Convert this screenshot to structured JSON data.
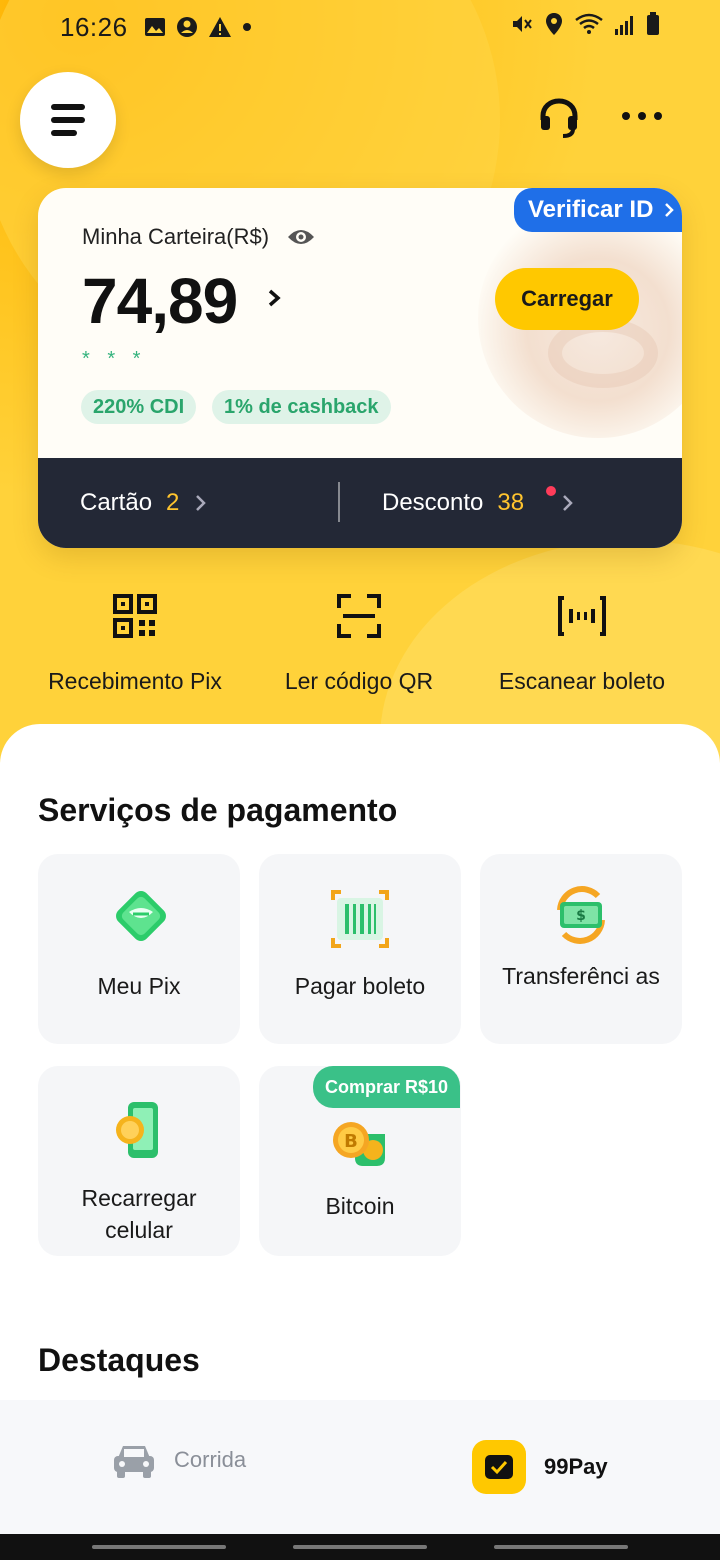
{
  "status_bar": {
    "time": "16:26"
  },
  "header": {
    "menu_icon": "hamburger-icon",
    "support_icon": "headset-icon",
    "more_icon": "more-dots-icon"
  },
  "wallet": {
    "label": "Minha Carteira(R$)",
    "balance": "74,89",
    "masked": "* * *",
    "tags": [
      "220% CDI",
      "1% de cashback"
    ],
    "charge_button": "Carregar",
    "verify_badge": "Verificar ID",
    "card_label": "Cartão",
    "card_count": "2",
    "discount_label": "Desconto",
    "discount_count": "38"
  },
  "quick_actions": [
    {
      "label": "Recebimento Pix",
      "icon": "qr-code-icon"
    },
    {
      "label": "Ler código QR",
      "icon": "scan-frame-icon"
    },
    {
      "label": "Escanear boleto",
      "icon": "barcode-scan-icon"
    }
  ],
  "payment_services": {
    "title": "Serviços de pagamento",
    "items": [
      {
        "label": "Meu Pix",
        "icon": "pix-icon"
      },
      {
        "label": "Pagar boleto",
        "icon": "boleto-icon"
      },
      {
        "label": "Transferênci as",
        "icon": "transfer-money-icon"
      },
      {
        "label": "Recarregar celular",
        "icon": "phone-recharge-icon"
      },
      {
        "label": "Bitcoin",
        "icon": "bitcoin-icon"
      }
    ],
    "bitcoin_badge": "Comprar R$10"
  },
  "highlights": {
    "title": "Destaques"
  },
  "bottom_nav": [
    {
      "label": "Corrida",
      "icon": "car-icon"
    },
    {
      "label": "99Pay",
      "icon": "wallet-check-icon"
    }
  ],
  "colors": {
    "brand_yellow": "#ffc800",
    "verify_blue": "#1f6fe8",
    "card_dark": "#232836",
    "green_tag": "#2aa56c",
    "badge_green": "#3ac188"
  }
}
